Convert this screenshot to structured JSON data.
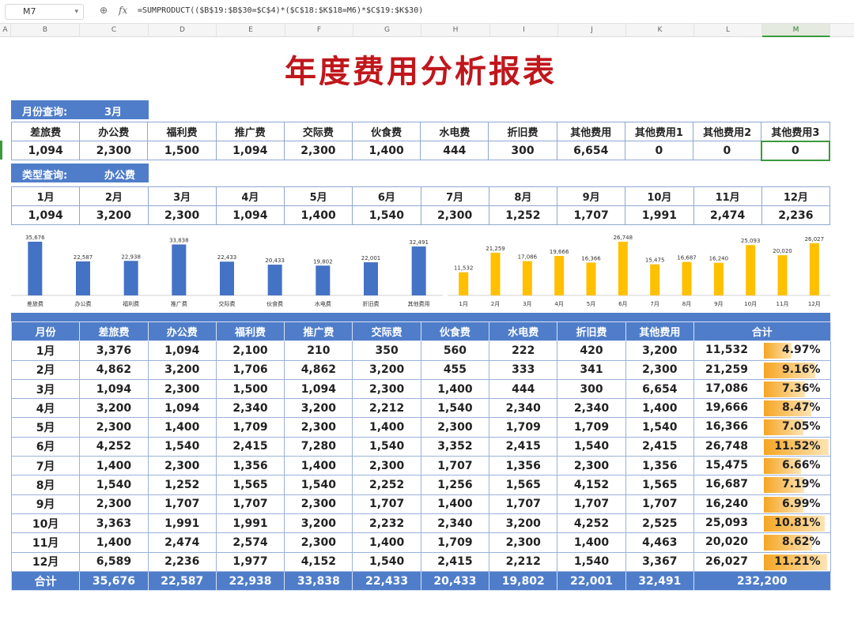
{
  "formula_bar": {
    "cell_ref": "M7",
    "fx_label": "fx",
    "formula": "=SUMPRODUCT(($B$19:$B$30=$C$4)*($C$18:$K$18=M6)*$C$19:$K$30)"
  },
  "columns": [
    "A",
    "B",
    "C",
    "D",
    "E",
    "F",
    "G",
    "H",
    "I",
    "J",
    "K",
    "L",
    "M"
  ],
  "title": "年度费用分析报表",
  "month_query": {
    "label": "月份查询:",
    "value": "3月"
  },
  "month_table": {
    "headers": [
      "差旅费",
      "办公费",
      "福利费",
      "推广费",
      "交际费",
      "伙食费",
      "水电费",
      "折旧费",
      "其他费用",
      "其他费用1",
      "其他费用2",
      "其他费用3"
    ],
    "values": [
      "1,094",
      "2,300",
      "1,500",
      "1,094",
      "2,300",
      "1,400",
      "444",
      "300",
      "6,654",
      "0",
      "0",
      "0"
    ]
  },
  "type_query": {
    "label": "类型查询:",
    "value": "办公费"
  },
  "type_table": {
    "headers": [
      "1月",
      "2月",
      "3月",
      "4月",
      "5月",
      "6月",
      "7月",
      "8月",
      "9月",
      "10月",
      "11月",
      "12月"
    ],
    "values": [
      "1,094",
      "3,200",
      "2,300",
      "1,094",
      "1,400",
      "1,540",
      "2,300",
      "1,252",
      "1,707",
      "1,991",
      "2,474",
      "2,236"
    ]
  },
  "chart_data": [
    {
      "type": "bar",
      "categories": [
        "差旅费",
        "办公费",
        "福利费",
        "推广费",
        "交际费",
        "伙食费",
        "水电费",
        "折旧费",
        "其他费用"
      ],
      "values": [
        35676,
        22587,
        22938,
        33838,
        22433,
        20433,
        19802,
        22001,
        32491
      ],
      "labels": [
        "35,676",
        "22,587",
        "22,938",
        "33,838",
        "22,433",
        "20,433",
        "19,802",
        "22,001",
        "32,491"
      ],
      "color": "#4472c4"
    },
    {
      "type": "bar",
      "categories": [
        "1月",
        "2月",
        "3月",
        "4月",
        "5月",
        "6月",
        "7月",
        "8月",
        "9月",
        "10月",
        "11月",
        "12月"
      ],
      "values": [
        11532,
        21259,
        17086,
        19666,
        16366,
        26748,
        15475,
        16687,
        16240,
        25093,
        20020,
        26027
      ],
      "labels": [
        "11,532",
        "21,259",
        "17,086",
        "19,666",
        "16,366",
        "26,748",
        "15,475",
        "16,687",
        "16,240",
        "25,093",
        "20,020",
        "26,027"
      ],
      "color": "#ffc000"
    }
  ],
  "main_table": {
    "headers": [
      "月份",
      "差旅费",
      "办公费",
      "福利费",
      "推广费",
      "交际费",
      "伙食费",
      "水电费",
      "折旧费",
      "其他费用",
      "合计"
    ],
    "rows": [
      {
        "month": "1月",
        "cells": [
          "3,376",
          "1,094",
          "2,100",
          "210",
          "350",
          "560",
          "222",
          "420",
          "3,200"
        ],
        "total": "11,532",
        "pct": "4.97%",
        "pct_value": 4.97
      },
      {
        "month": "2月",
        "cells": [
          "4,862",
          "3,200",
          "1,706",
          "4,862",
          "3,200",
          "455",
          "333",
          "341",
          "2,300"
        ],
        "total": "21,259",
        "pct": "9.16%",
        "pct_value": 9.16
      },
      {
        "month": "3月",
        "cells": [
          "1,094",
          "2,300",
          "1,500",
          "1,094",
          "2,300",
          "1,400",
          "444",
          "300",
          "6,654"
        ],
        "total": "17,086",
        "pct": "7.36%",
        "pct_value": 7.36
      },
      {
        "month": "4月",
        "cells": [
          "3,200",
          "1,094",
          "2,340",
          "3,200",
          "2,212",
          "1,540",
          "2,340",
          "2,340",
          "1,400"
        ],
        "total": "19,666",
        "pct": "8.47%",
        "pct_value": 8.47
      },
      {
        "month": "5月",
        "cells": [
          "2,300",
          "1,400",
          "1,709",
          "2,300",
          "1,400",
          "2,300",
          "1,709",
          "1,709",
          "1,540"
        ],
        "total": "16,366",
        "pct": "7.05%",
        "pct_value": 7.05
      },
      {
        "month": "6月",
        "cells": [
          "4,252",
          "1,540",
          "2,415",
          "7,280",
          "1,540",
          "3,352",
          "2,415",
          "1,540",
          "2,415"
        ],
        "total": "26,748",
        "pct": "11.52%",
        "pct_value": 11.52
      },
      {
        "month": "7月",
        "cells": [
          "1,400",
          "2,300",
          "1,356",
          "1,400",
          "2,300",
          "1,707",
          "1,356",
          "2,300",
          "1,356"
        ],
        "total": "15,475",
        "pct": "6.66%",
        "pct_value": 6.66
      },
      {
        "month": "8月",
        "cells": [
          "1,540",
          "1,252",
          "1,565",
          "1,540",
          "2,252",
          "1,256",
          "1,565",
          "4,152",
          "1,565"
        ],
        "total": "16,687",
        "pct": "7.19%",
        "pct_value": 7.19
      },
      {
        "month": "9月",
        "cells": [
          "2,300",
          "1,707",
          "1,707",
          "2,300",
          "1,707",
          "1,400",
          "1,707",
          "1,707",
          "1,707"
        ],
        "total": "16,240",
        "pct": "6.99%",
        "pct_value": 6.99
      },
      {
        "month": "10月",
        "cells": [
          "3,363",
          "1,991",
          "1,991",
          "3,200",
          "2,232",
          "2,340",
          "3,200",
          "4,252",
          "2,525"
        ],
        "total": "25,093",
        "pct": "10.81%",
        "pct_value": 10.81
      },
      {
        "month": "11月",
        "cells": [
          "1,400",
          "2,474",
          "2,574",
          "2,300",
          "1,400",
          "1,709",
          "2,300",
          "1,400",
          "4,463"
        ],
        "total": "20,020",
        "pct": "8.62%",
        "pct_value": 8.62
      },
      {
        "month": "12月",
        "cells": [
          "6,589",
          "2,236",
          "1,977",
          "4,152",
          "1,540",
          "2,415",
          "2,212",
          "1,540",
          "3,367"
        ],
        "total": "26,027",
        "pct": "11.21%",
        "pct_value": 11.21
      }
    ],
    "footer": {
      "label": "合计",
      "cells": [
        "35,676",
        "22,587",
        "22,938",
        "33,838",
        "22,433",
        "20,433",
        "19,802",
        "22,001",
        "32,491"
      ],
      "grand_total": "232,200"
    }
  },
  "colors": {
    "accent_blue": "#4f7dc9",
    "title_red": "#c0171c",
    "selection_green": "#3a9a3e"
  }
}
